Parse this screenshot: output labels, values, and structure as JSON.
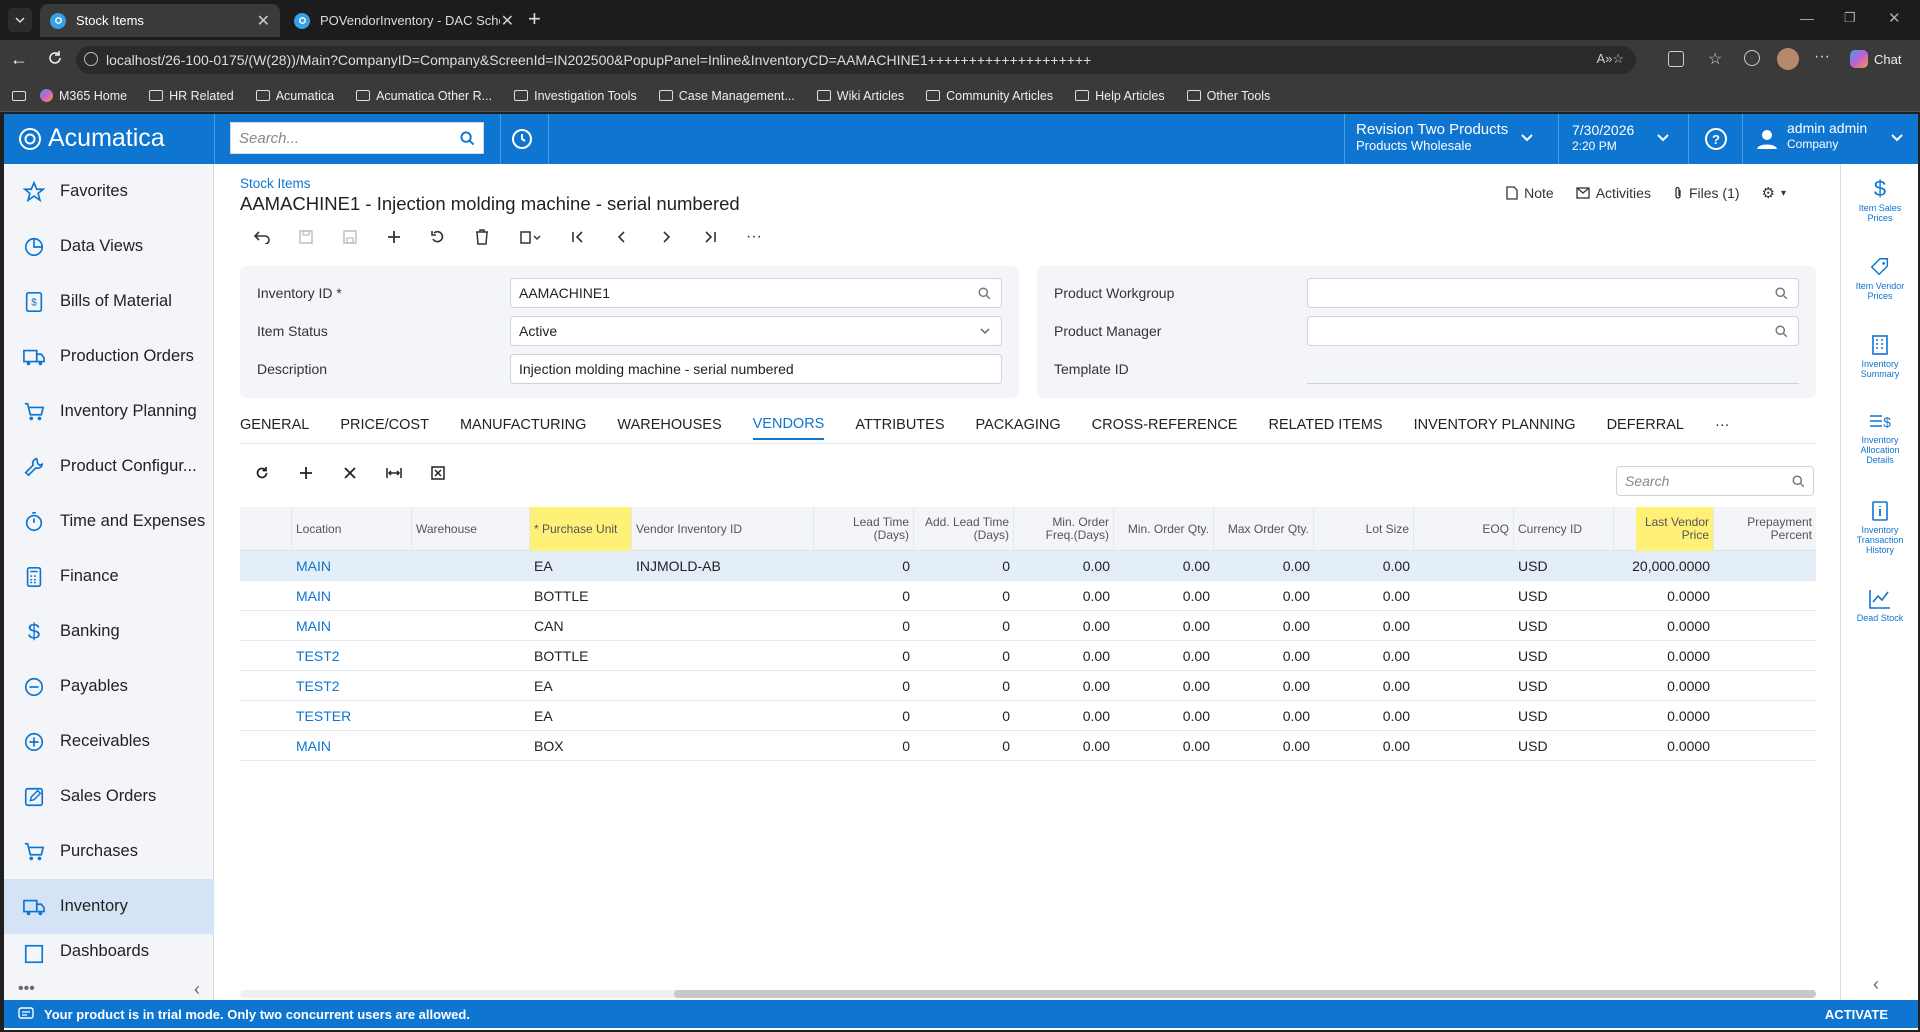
{
  "browser": {
    "tabs": [
      {
        "title": "Stock Items"
      },
      {
        "title": "POVendorInventory - DAC Schema"
      }
    ],
    "url": "localhost/26-100-0175/(W(28))/Main?CompanyID=Company&ScreenId=IN202500&PopupPanel=Inline&InventoryCD=AAMACHINE1++++++++++++++++++++",
    "chat_label": "Chat",
    "bookmarks": [
      "M365 Home",
      "HR Related",
      "Acumatica",
      "Acumatica Other R...",
      "Investigation Tools",
      "Case Management...",
      "Wiki Articles",
      "Community Articles",
      "Help Articles",
      "Other Tools"
    ]
  },
  "topnav": {
    "logo": "Acumatica",
    "search_placeholder": "Search...",
    "company_name": "Revision Two Products",
    "company_sub": "Products Wholesale",
    "date": "7/30/2026",
    "time": "2:20 PM",
    "user_name": "admin admin",
    "user_company": "Company"
  },
  "sidebar": {
    "items": [
      "Favorites",
      "Data Views",
      "Bills of Material",
      "Production Orders",
      "Inventory Planning",
      "Product Configur...",
      "Time and Expenses",
      "Finance",
      "Banking",
      "Payables",
      "Receivables",
      "Sales Orders",
      "Purchases",
      "Inventory",
      "Dashboards"
    ]
  },
  "page": {
    "breadcrumb": "Stock Items",
    "title": "AAMACHINE1 - Injection molding machine - serial numbered",
    "actions": {
      "note": "Note",
      "activities": "Activities",
      "files": "Files (1)"
    }
  },
  "form": {
    "left": [
      {
        "label": "Inventory ID *",
        "value": "AAMACHINE1"
      },
      {
        "label": "Item Status",
        "value": "Active"
      },
      {
        "label": "Description",
        "value": "Injection molding machine - serial numbered"
      }
    ],
    "right": [
      {
        "label": "Product Workgroup",
        "value": ""
      },
      {
        "label": "Product Manager",
        "value": ""
      },
      {
        "label": "Template ID",
        "value": ""
      }
    ]
  },
  "tabs": [
    "GENERAL",
    "PRICE/COST",
    "MANUFACTURING",
    "WAREHOUSES",
    "VENDORS",
    "ATTRIBUTES",
    "PACKAGING",
    "CROSS-REFERENCE",
    "RELATED ITEMS",
    "INVENTORY PLANNING",
    "DEFERRAL",
    "···"
  ],
  "grid": {
    "search_placeholder": "Search",
    "columns": [
      {
        "l1": "Location",
        "l2": ""
      },
      {
        "l1": "Warehouse",
        "l2": ""
      },
      {
        "l1": "* Purchase Unit",
        "l2": ""
      },
      {
        "l1": "Vendor Inventory ID",
        "l2": ""
      },
      {
        "l1": "Lead Time",
        "l2": "(Days)"
      },
      {
        "l1": "Add. Lead Time",
        "l2": "(Days)"
      },
      {
        "l1": "Min. Order",
        "l2": "Freq.(Days)"
      },
      {
        "l1": "Min. Order Qty.",
        "l2": ""
      },
      {
        "l1": "Max Order Qty.",
        "l2": ""
      },
      {
        "l1": "Lot Size",
        "l2": ""
      },
      {
        "l1": "EOQ",
        "l2": ""
      },
      {
        "l1": "Currency ID",
        "l2": ""
      },
      {
        "l1": "Last Vendor",
        "l2": "Price"
      },
      {
        "l1": "Prepayment",
        "l2": "Percent"
      }
    ],
    "rows": [
      [
        "MAIN",
        "",
        "EA",
        "INJMOLD-AB",
        "0",
        "0",
        "0.00",
        "0.00",
        "0.00",
        "0.00",
        "USD",
        "20,000.0000"
      ],
      [
        "MAIN",
        "",
        "BOTTLE",
        "",
        "0",
        "0",
        "0.00",
        "0.00",
        "0.00",
        "0.00",
        "USD",
        "0.0000"
      ],
      [
        "MAIN",
        "",
        "CAN",
        "",
        "0",
        "0",
        "0.00",
        "0.00",
        "0.00",
        "0.00",
        "USD",
        "0.0000"
      ],
      [
        "TEST2",
        "",
        "BOTTLE",
        "",
        "0",
        "0",
        "0.00",
        "0.00",
        "0.00",
        "0.00",
        "USD",
        "0.0000"
      ],
      [
        "TEST2",
        "",
        "EA",
        "",
        "0",
        "0",
        "0.00",
        "0.00",
        "0.00",
        "0.00",
        "USD",
        "0.0000"
      ],
      [
        "TESTER",
        "",
        "EA",
        "",
        "0",
        "0",
        "0.00",
        "0.00",
        "0.00",
        "0.00",
        "USD",
        "0.0000"
      ],
      [
        "MAIN",
        "",
        "BOX",
        "",
        "0",
        "0",
        "0.00",
        "0.00",
        "0.00",
        "0.00",
        "USD",
        "0.0000"
      ]
    ]
  },
  "right_panel": [
    [
      "Item Sales",
      "Prices"
    ],
    [
      "Item Vendor",
      "Prices"
    ],
    [
      "Inventory",
      "Summary"
    ],
    [
      "Inventory",
      "Allocation",
      "Details"
    ],
    [
      "Inventory",
      "Transaction",
      "History"
    ],
    [
      "Dead Stock"
    ]
  ],
  "footer": {
    "trial_message": "Your product is in trial mode. Only two concurrent users are allowed.",
    "activate": "ACTIVATE"
  },
  "colors": {
    "brand": "#0e75d0",
    "highlight": "#fff178",
    "selected_row": "#e4eef9"
  }
}
